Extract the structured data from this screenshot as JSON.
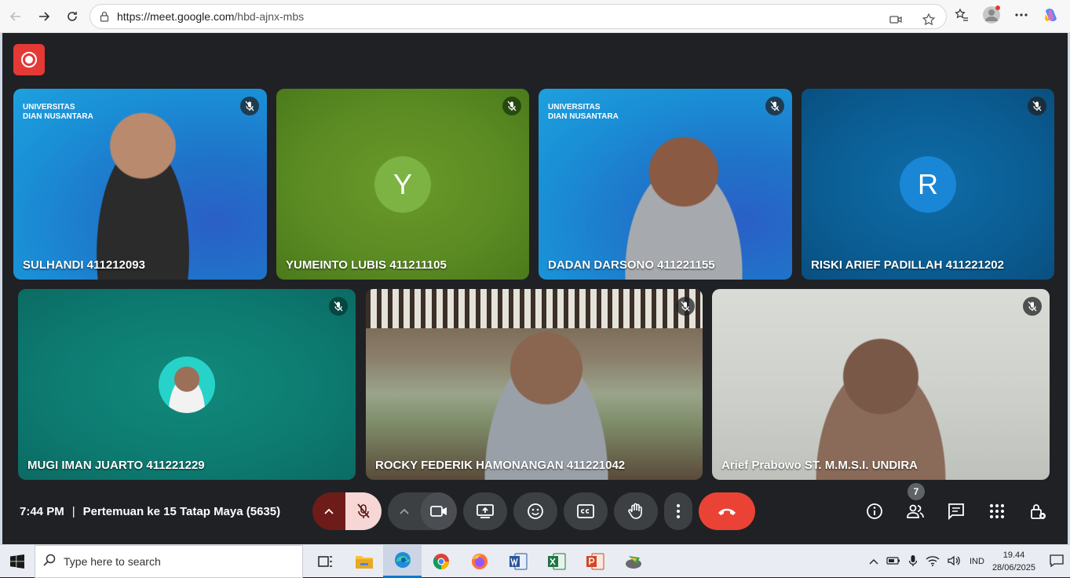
{
  "browser": {
    "url_host": "https://meet.google.com",
    "url_path": "/hbd-ajnx-mbs"
  },
  "participants": [
    {
      "name": "SULHANDI 411212093"
    },
    {
      "name": "YUMEINTO LUBIS 411211105",
      "initial": "Y"
    },
    {
      "name": "DADAN DARSONO 411221155"
    },
    {
      "name": "RISKI ARIEF PADILLAH 411221202",
      "initial": "R"
    },
    {
      "name": "MUGI IMAN JUARTO 411221229"
    },
    {
      "name": "ROCKY FEDERIK HAMONANGAN 411221042"
    },
    {
      "name": "Arief Prabowo ST. M.M.S.I. UNDIRA"
    }
  ],
  "university_logo": {
    "line1": "UNIVERSITAS",
    "line2": "DIAN NUSANTARA"
  },
  "meeting": {
    "time": "7:44 PM",
    "separator": "|",
    "title": "Pertemuan ke 15 Tatap Maya (5635)",
    "people_count": "7"
  },
  "taskbar": {
    "search_placeholder": "Type here to search",
    "lang": "IND",
    "time": "19.44",
    "date": "28/06/2025"
  },
  "colors": {
    "end_call": "#ea4335",
    "record": "#e53935",
    "mic_off": "#f6d7d5"
  }
}
